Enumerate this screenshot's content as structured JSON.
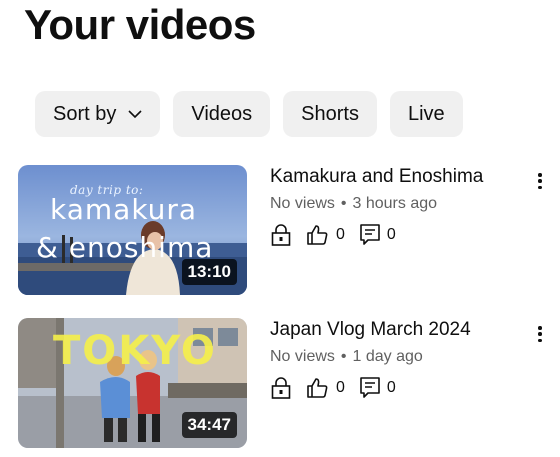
{
  "page": {
    "title": "Your videos"
  },
  "filters": {
    "sort_label": "Sort by",
    "chips": [
      "Videos",
      "Shorts",
      "Live"
    ]
  },
  "videos": [
    {
      "title": "Kamakura and Enoshima",
      "views": "No views",
      "age": "3 hours ago",
      "likes": "0",
      "comments": "0",
      "duration": "13:10",
      "thumb_small_text": "day trip to:",
      "thumb_line1": "kamakura",
      "thumb_line2": "& enoshima"
    },
    {
      "title": "Japan Vlog March 2024",
      "views": "No views",
      "age": "1 day ago",
      "likes": "0",
      "comments": "0",
      "duration": "34:47",
      "thumb_text": "TOKYO"
    }
  ]
}
